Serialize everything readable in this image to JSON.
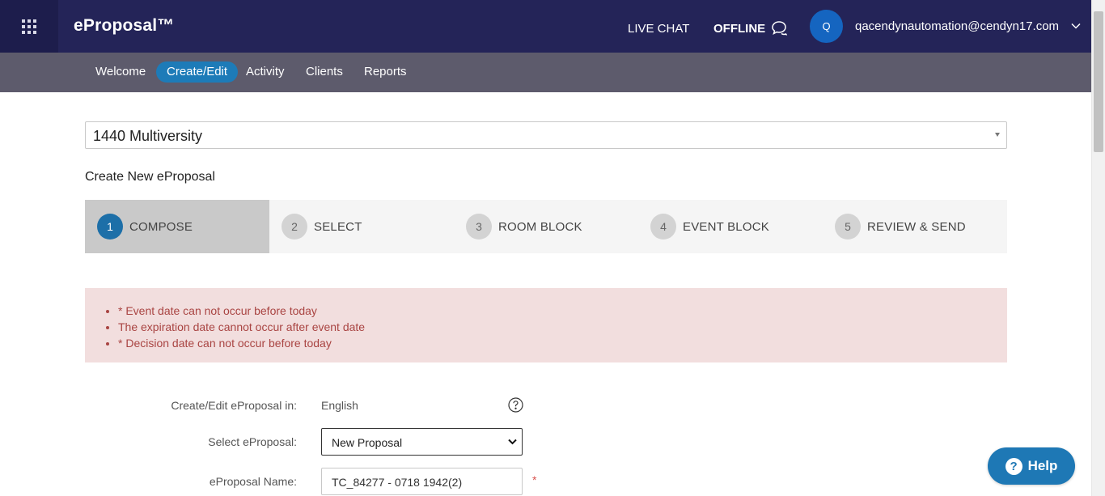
{
  "topbar": {
    "brand": "eProposal™",
    "live_chat": "LIVE CHAT",
    "offline": "OFFLINE",
    "avatar_initial": "Q",
    "user_email": "qacendynautomation@cendyn17.com"
  },
  "nav": {
    "items": [
      {
        "label": "Welcome",
        "active": false
      },
      {
        "label": "Create/Edit",
        "active": true
      },
      {
        "label": "Activity",
        "active": false
      },
      {
        "label": "Clients",
        "active": false
      },
      {
        "label": "Reports",
        "active": false
      }
    ]
  },
  "property_select": {
    "value": "1440 Multiversity"
  },
  "page_heading": "Create New eProposal",
  "steps": [
    {
      "num": "1",
      "label": "COMPOSE",
      "active": true
    },
    {
      "num": "2",
      "label": "SELECT",
      "active": false
    },
    {
      "num": "3",
      "label": "ROOM BLOCK",
      "active": false
    },
    {
      "num": "4",
      "label": "EVENT BLOCK",
      "active": false
    },
    {
      "num": "5",
      "label": "REVIEW & SEND",
      "active": false
    }
  ],
  "errors": [
    "* Event date can not occur before today",
    "The expiration date cannot occur after event date",
    "* Decision date can not occur before today"
  ],
  "form": {
    "language_label": "Create/Edit eProposal in:",
    "language_value": "English",
    "select_label": "Select eProposal:",
    "select_value": "New Proposal",
    "name_label": "eProposal Name:",
    "name_value": "TC_84277 - 0718 1942(2)",
    "required_mark": "*"
  },
  "help_button": {
    "label": "Help",
    "icon_glyph": "?"
  },
  "icons": {
    "apps": "apps-grid-icon",
    "chat": "chat-bubble-icon",
    "chevron": "chevron-down-icon",
    "help": "question-circle-icon"
  },
  "colors": {
    "topbar": "#242458",
    "navbar": "#5d5b6c",
    "accent": "#1d7bb8",
    "error_bg": "#f2dede",
    "error_text": "#a94442"
  }
}
